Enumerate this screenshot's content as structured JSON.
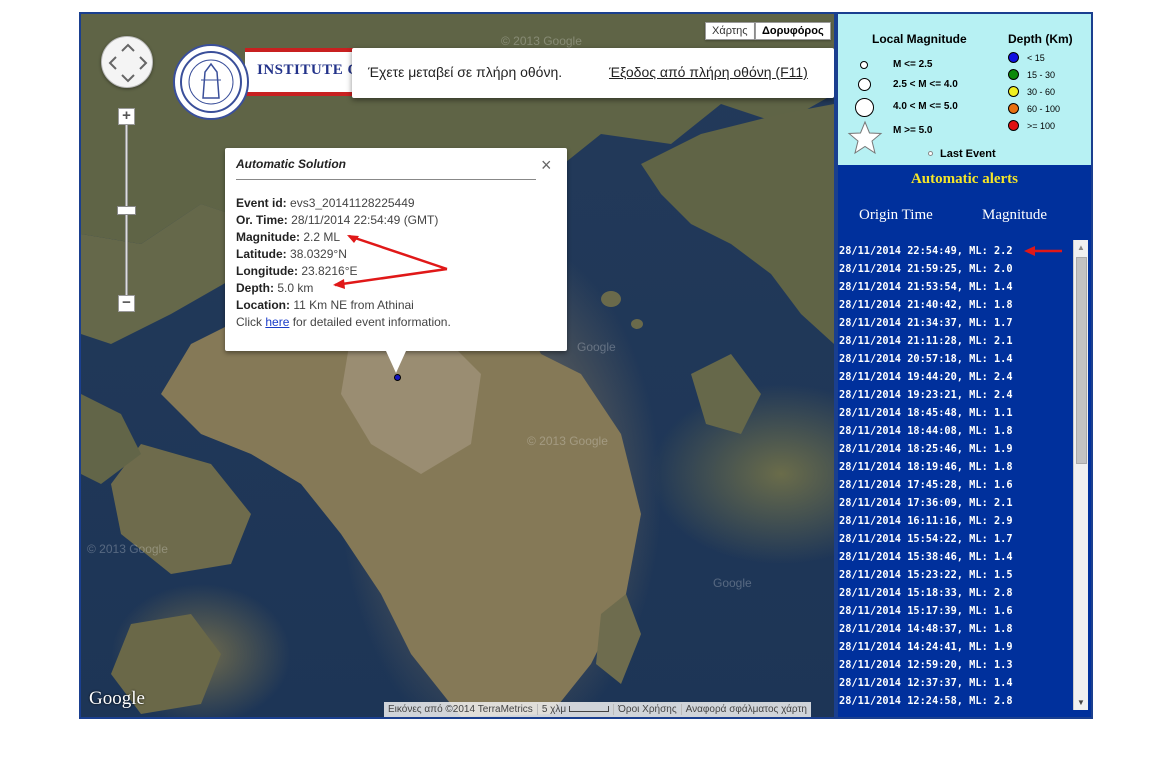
{
  "map": {
    "map_type_buttons": [
      "Χάρτης",
      "Δορυφόρος"
    ],
    "logo_text": "INSTITUTE OF",
    "fullscreen_notice": {
      "message": "Έχετε μεταβεί σε πλήρη οθόνη.",
      "exit_label": "Έξοδος από πλήρη οθόνη (F11)"
    },
    "google_label": "Google",
    "attribution": {
      "imagery": "Εικόνες από ©2014 TerraMetrics",
      "scale": "5 χλμ",
      "terms": "Όροι Χρήσης",
      "report": "Αναφορά σφάλματος χάρτη"
    },
    "watermarks": [
      "© 2013 Google",
      "© 2013 Google",
      "© 2013 Google",
      "Google",
      "Google"
    ]
  },
  "popup": {
    "title": "Automatic Solution",
    "close": "×",
    "fields": [
      {
        "label": "Event id:",
        "value": "evs3_20141128225449"
      },
      {
        "label": "Or. Time:",
        "value": "28/11/2014  22:54:49 (GMT)"
      },
      {
        "label": "Magnitude:",
        "value": "2.2 ML"
      },
      {
        "label": "Latitude:",
        "value": "38.0329°N"
      },
      {
        "label": "Longitude:",
        "value": "23.8216°E"
      },
      {
        "label": "Depth:",
        "value": "5.0 km"
      },
      {
        "label": "Location:",
        "value": "11 Km NE from Athinai"
      }
    ],
    "click_prefix": "Click ",
    "link_text": "here",
    "click_suffix": " for detailed event information."
  },
  "legend": {
    "magnitude_title": "Local Magnitude",
    "depth_title": "Depth (Km)",
    "magnitude_classes": [
      "M <= 2.5",
      "2.5 < M <= 4.0",
      "4.0 < M <= 5.0",
      "M >= 5.0"
    ],
    "depth_classes": [
      {
        "label": "< 15",
        "color": "#1010e0"
      },
      {
        "label": "15 - 30",
        "color": "#0a8a0a"
      },
      {
        "label": "30 - 60",
        "color": "#f0f020"
      },
      {
        "label": "60 - 100",
        "color": "#e87010"
      },
      {
        "label": ">= 100",
        "color": "#e01010"
      }
    ],
    "last_event": "Last Event"
  },
  "alerts": {
    "title": "Automatic alerts",
    "col_time": "Origin Time",
    "col_magnitude": "Magnitude",
    "rows": [
      "28/11/2014 22:54:49,  ML: 2.2",
      "28/11/2014 21:59:25,  ML: 2.0",
      "28/11/2014 21:53:54,  ML: 1.4",
      "28/11/2014 21:40:42,  ML: 1.8",
      "28/11/2014 21:34:37,  ML: 1.7",
      "28/11/2014 21:11:28,  ML: 2.1",
      "28/11/2014 20:57:18,  ML: 1.4",
      "28/11/2014 19:44:20,  ML: 2.4",
      "28/11/2014 19:23:21,  ML: 2.4",
      "28/11/2014 18:45:48,  ML: 1.1",
      "28/11/2014 18:44:08,  ML: 1.8",
      "28/11/2014 18:25:46,  ML: 1.9",
      "28/11/2014 18:19:46,  ML: 1.8",
      "28/11/2014 17:45:28,  ML: 1.6",
      "28/11/2014 17:36:09,  ML: 2.1",
      "28/11/2014 16:11:16,  ML: 2.9",
      "28/11/2014 15:54:22,  ML: 1.7",
      "28/11/2014 15:38:46,  ML: 1.4",
      "28/11/2014 15:23:22,  ML: 1.5",
      "28/11/2014 15:18:33,  ML: 2.8",
      "28/11/2014 15:17:39,  ML: 1.6",
      "28/11/2014 14:48:37,  ML: 1.8",
      "28/11/2014 14:24:41,  ML: 1.9",
      "28/11/2014 12:59:20,  ML: 1.3",
      "28/11/2014 12:37:37,  ML: 1.4",
      "28/11/2014 12:24:58,  ML: 2.8"
    ]
  },
  "colors": {
    "panel_blue": "#00309c",
    "legend_bg": "#b7f1f3",
    "alerts_title": "#f4e52a",
    "arrow_red": "#e01818"
  }
}
